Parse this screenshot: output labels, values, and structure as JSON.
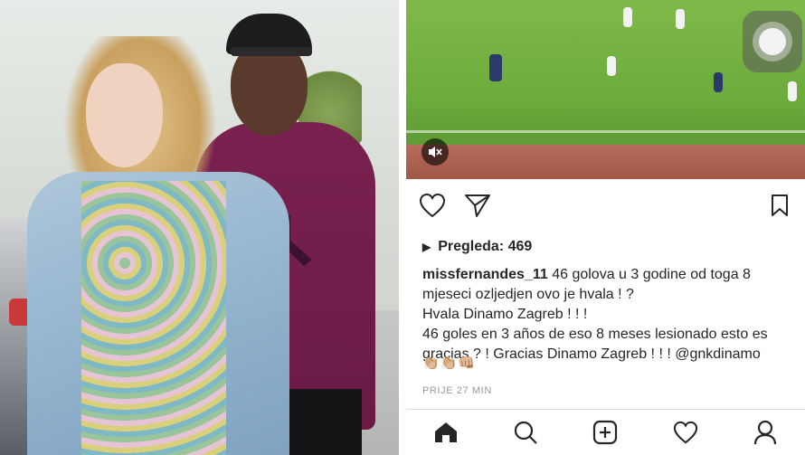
{
  "photo": {
    "description_icon": "photo-icon"
  },
  "post": {
    "views_label": "Pregleda: 469",
    "username": "missfernandes_11",
    "caption_lines": [
      "46 golova u 3 godine od toga 8 mjeseci ozljedjen ovo je hvala ! ?",
      "Hvala Dinamo Zagreb ! ! !",
      "46 goles en 3 años de eso 8 meses lesionado esto es gracias ? !  Gracias Dinamo Zagreb ! ! ! @gnkdinamo"
    ],
    "emojis": "👏🏼👏🏼👊🏼",
    "timestamp": "PRIJE 27 MIN"
  },
  "icons": {
    "mute": "speaker-muted-icon",
    "assistive_touch": "assistive-touch-icon",
    "like": "heart-icon",
    "share": "send-icon",
    "save": "bookmark-icon",
    "play": "play-icon",
    "home": "home-icon",
    "search": "search-icon",
    "add": "add-post-icon",
    "activity": "heart-icon",
    "profile": "profile-icon"
  },
  "colors": {
    "text": "#262626",
    "muted": "#999999",
    "border": "#dbdbdb",
    "field_green": "#6cab3d"
  }
}
